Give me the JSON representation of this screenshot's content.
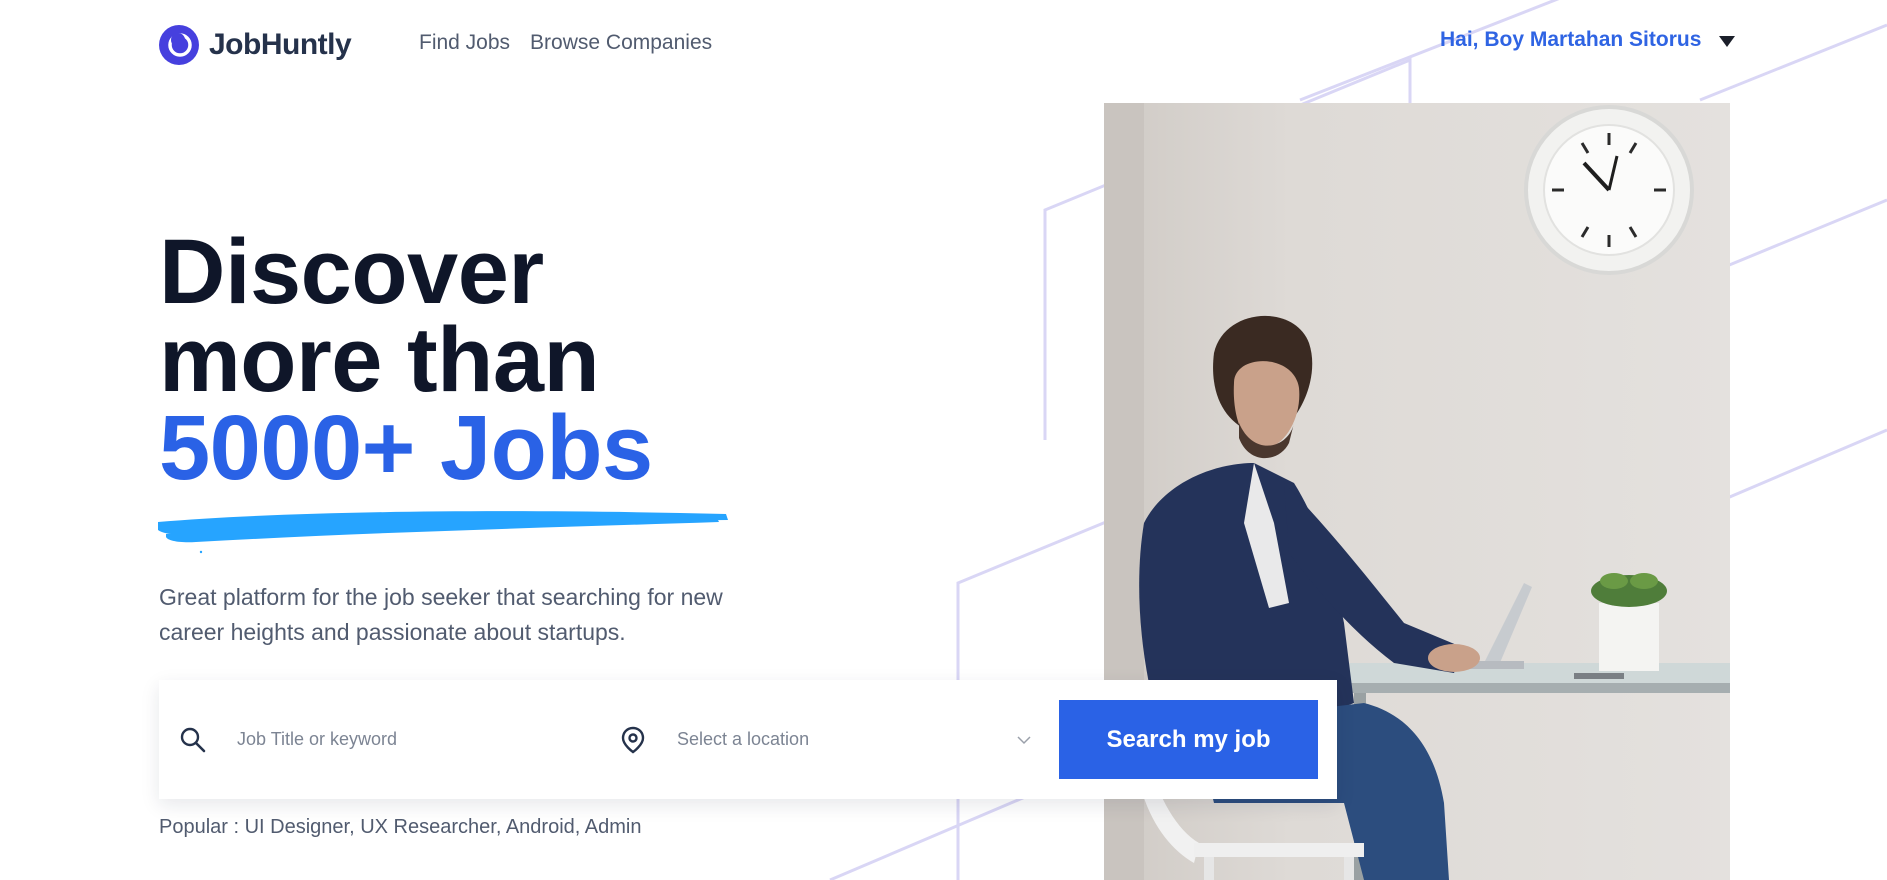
{
  "brand": {
    "name": "JobHuntly",
    "logo_icon": "logo-ring-icon",
    "color": "#4640DE"
  },
  "nav": {
    "items": [
      {
        "label": "Find Jobs"
      },
      {
        "label": "Browse Companies"
      }
    ]
  },
  "user": {
    "greeting": "Hai, Boy Martahan Sitorus",
    "menu_icon": "caret-down-icon"
  },
  "hero": {
    "line1": "Discover",
    "line2": "more than",
    "highlight": "5000+ Jobs",
    "subtitle": "Great platform for the job seeker that searching for new career heights and passionate about startups."
  },
  "search": {
    "keyword_placeholder": "Job Title or keyword",
    "keyword_icon": "search-icon",
    "location_placeholder": "Select a location",
    "location_icon": "location-pin-icon",
    "button_label": "Search my job"
  },
  "popular": {
    "text": "Popular : UI Designer, UX Researcher, Android, Admin"
  },
  "colors": {
    "accent": "#2a62e6",
    "heading": "#0f1629",
    "body": "#515B6F",
    "underline": "#26A4FF"
  }
}
